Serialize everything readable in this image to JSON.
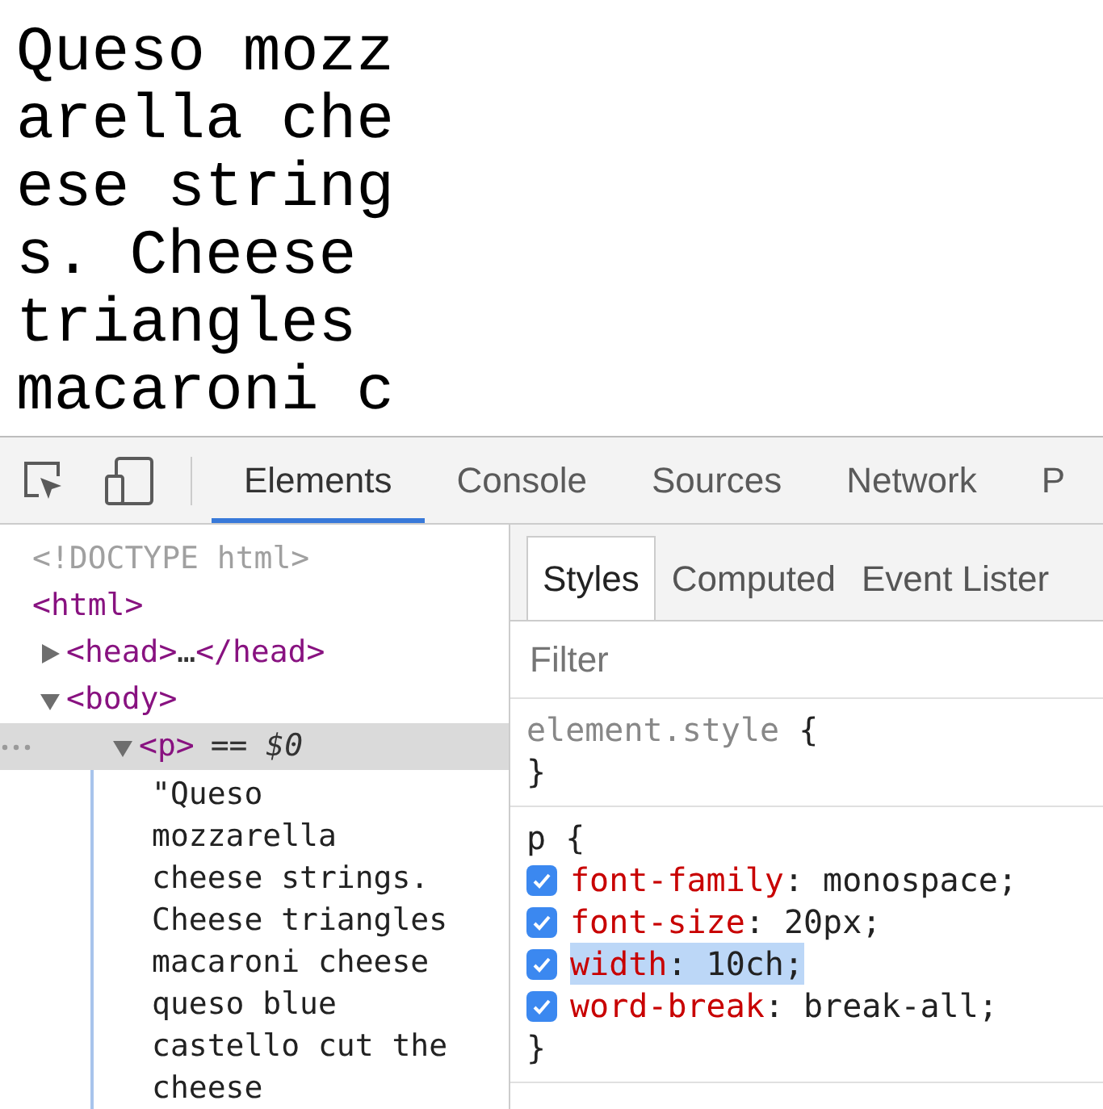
{
  "preview": {
    "lines": [
      "Queso mozz",
      "arella che",
      "ese string",
      "s. Cheese",
      "triangles",
      "macaroni c"
    ]
  },
  "devtools": {
    "tabs": [
      {
        "label": "Elements",
        "selected": true
      },
      {
        "label": "Console",
        "selected": false
      },
      {
        "label": "Sources",
        "selected": false
      },
      {
        "label": "Network",
        "selected": false
      },
      {
        "label": "P",
        "selected": false
      }
    ],
    "dom_tree": [
      {
        "kind": "doctype",
        "text": "<!DOCTYPE html>"
      },
      {
        "kind": "element",
        "open": "<html>",
        "children": [
          {
            "kind": "element",
            "open": "<head>",
            "ellipsis": "…",
            "close": "</head>",
            "expanded": false
          },
          {
            "kind": "element",
            "open": "<body>",
            "expanded": true,
            "children": [
              {
                "kind": "element",
                "open": "<p>",
                "badge": "== *$0*",
                "expanded": true,
                "selected": true,
                "children": [
                  {
                    "kind": "text",
                    "lines": [
                      "\"Queso",
                      "mozzarella",
                      "cheese strings.",
                      "Cheese triangles",
                      "macaroni cheese",
                      "queso blue",
                      "castello cut the",
                      "cheese"
                    ]
                  }
                ]
              }
            ]
          }
        ]
      }
    ],
    "sidebar_tabs": [
      {
        "label": "Styles",
        "selected": true
      },
      {
        "label": "Computed",
        "selected": false
      },
      {
        "label": "Event Lister",
        "selected": false
      }
    ],
    "filter": {
      "placeholder": "Filter"
    },
    "rules": [
      {
        "kind": "inline",
        "selector": "element.style",
        "open": "{",
        "close": "}"
      },
      {
        "kind": "rule",
        "selector": "p",
        "open": "{",
        "close": "}",
        "declarations": [
          {
            "property": "font-family",
            "value": ": monospace;",
            "checked": true,
            "selected": false
          },
          {
            "property": "font-size",
            "value": ": 20px;",
            "checked": true,
            "selected": false
          },
          {
            "property": "width",
            "value": ": 10ch;",
            "checked": true,
            "selected": true
          },
          {
            "property": "word-break",
            "value": ": break-all;",
            "checked": true,
            "selected": false
          }
        ]
      }
    ]
  }
}
